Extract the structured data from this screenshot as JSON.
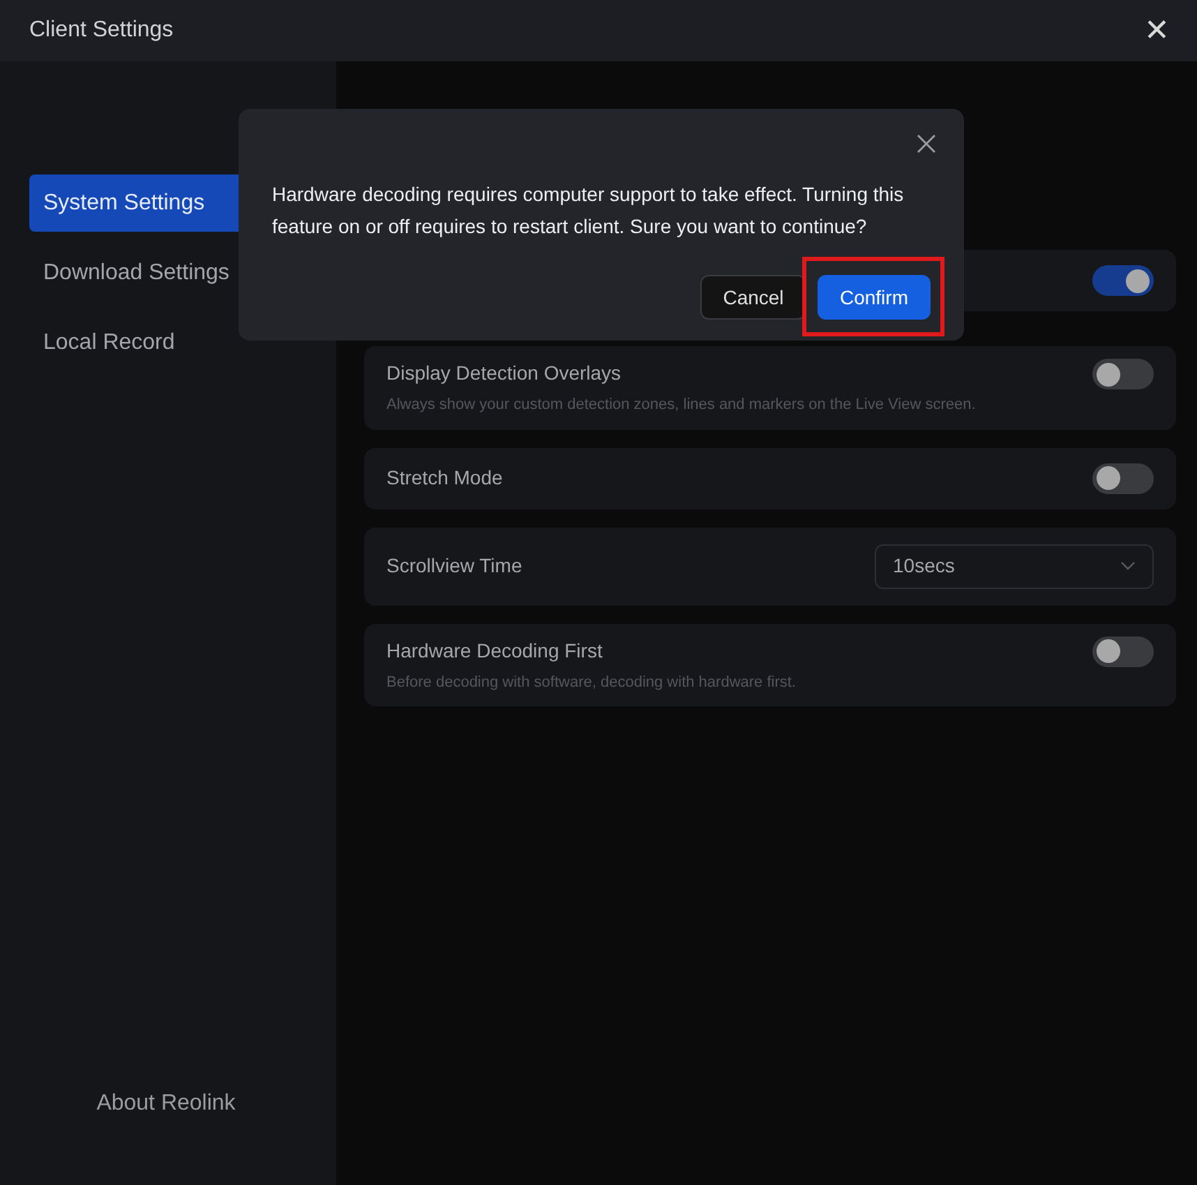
{
  "window": {
    "title": "Client Settings",
    "close": "✕"
  },
  "sidebar": {
    "items": [
      {
        "label": "System Settings",
        "selected": true
      },
      {
        "label": "Download Settings",
        "selected": false
      },
      {
        "label": "Local Record",
        "selected": false
      }
    ],
    "footer": "About Reolink"
  },
  "content": {
    "settings": [
      {
        "kind": "toggle",
        "on": true
      },
      {
        "kind": "toggle",
        "label": "Display Detection Overlays",
        "description": "Always show your custom detection zones, lines and markers on the Live View screen.",
        "on": false
      },
      {
        "kind": "toggle",
        "label": "Stretch Mode",
        "on": false
      },
      {
        "kind": "select",
        "label": "Scrollview Time",
        "value": "10secs"
      },
      {
        "kind": "toggle",
        "label": "Hardware Decoding First",
        "description": "Before decoding with software, decoding with hardware first.",
        "on": false
      }
    ]
  },
  "dialog": {
    "message": "Hardware decoding requires computer support to take effect. Turning this feature on or off requires to restart client. Sure you want to continue?",
    "buttons": [
      {
        "label": "Cancel",
        "kind": "secondary"
      },
      {
        "label": "Confirm",
        "kind": "primary",
        "highlighted": true
      }
    ]
  }
}
